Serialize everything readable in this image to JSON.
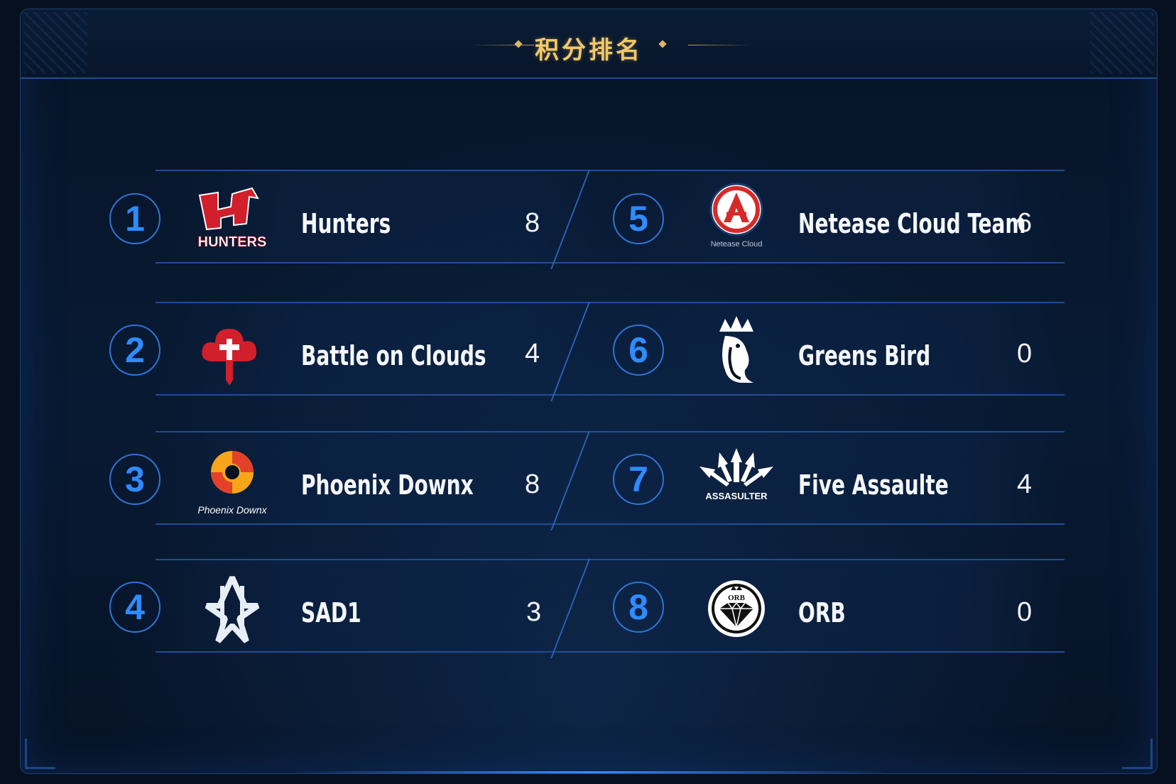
{
  "header": {
    "title": "积分排名"
  },
  "teams": [
    {
      "rank": "1",
      "name": "Hunters",
      "score": "8",
      "logo": "hunters-logo",
      "logo_text": "HUNTERS"
    },
    {
      "rank": "2",
      "name": "Battle on Clouds",
      "score": "4",
      "logo": "battle-on-clouds-logo",
      "logo_text": ""
    },
    {
      "rank": "3",
      "name": "Phoenix Downx",
      "score": "8",
      "logo": "phoenix-downx-logo",
      "logo_text": "Phoenix Downx"
    },
    {
      "rank": "4",
      "name": "SAD1",
      "score": "3",
      "logo": "sad1-logo",
      "logo_text": ""
    },
    {
      "rank": "5",
      "name": "Netease Cloud Team",
      "score": "6",
      "logo": "netease-cloud-logo",
      "logo_text": "Netease Cloud"
    },
    {
      "rank": "6",
      "name": "Greens Bird",
      "score": "0",
      "logo": "greens-bird-logo",
      "logo_text": ""
    },
    {
      "rank": "7",
      "name": "Five Assaulte",
      "score": "4",
      "logo": "five-assaulte-logo",
      "logo_text": "ASSASULTER"
    },
    {
      "rank": "8",
      "name": "ORB",
      "score": "0",
      "logo": "orb-logo",
      "logo_text": "ORB"
    }
  ],
  "colors": {
    "accent_blue": "#2f8bff",
    "title_gold": "#f2c86a",
    "background": "#06101f"
  }
}
